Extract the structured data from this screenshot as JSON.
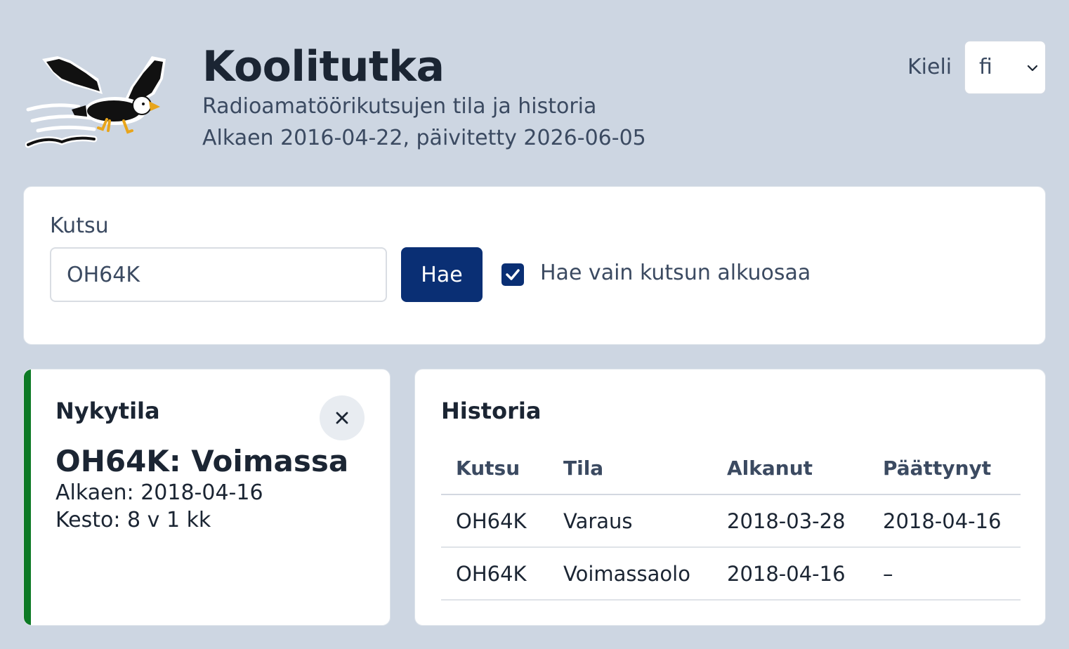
{
  "header": {
    "title": "Koolitutka",
    "subtitle": "Radioamatöörikutsujen tila ja historia",
    "since": "Alkaen 2016-04-22, päivitetty 2026-06-05",
    "logo_icon": "eagle-logo-icon",
    "language": {
      "label": "Kieli",
      "value": "fi"
    }
  },
  "search": {
    "label": "Kutsu",
    "value": "OH64K",
    "button_label": "Hae",
    "prefix_only_label": "Hae vain kutsun alkuosaa",
    "prefix_only_checked": true
  },
  "status": {
    "heading": "Nykytila",
    "main": "OH64K: Voimassa",
    "since": "Alkaen: 2018-04-16",
    "duration": "Kesto: 8 v 1 kk",
    "accent_color": "#0d7a25"
  },
  "history": {
    "heading": "Historia",
    "columns": [
      "Kutsu",
      "Tila",
      "Alkanut",
      "Päättynyt"
    ],
    "rows": [
      [
        "OH64K",
        "Varaus",
        "2018-03-28",
        "2018-04-16"
      ],
      [
        "OH64K",
        "Voimassaolo",
        "2018-04-16",
        "–"
      ]
    ]
  },
  "colors": {
    "primary": "#0a2f74",
    "background": "#cdd6e2"
  }
}
